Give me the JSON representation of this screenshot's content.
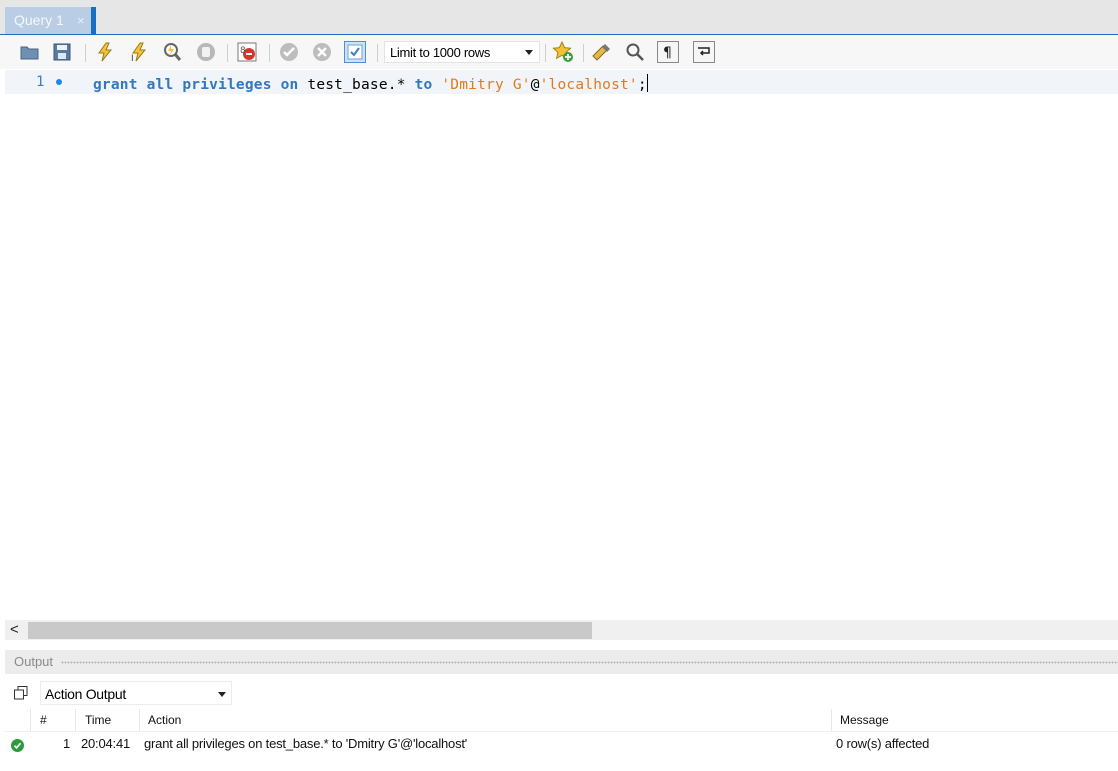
{
  "tabs": [
    {
      "label": "Query 1",
      "close": "×"
    }
  ],
  "toolbar": {
    "limit_select": "Limit to 1000 rows"
  },
  "editor": {
    "line_number": "1",
    "code_tokens": {
      "t1": "grant",
      "t2": "all",
      "t3": "privileges",
      "t4": "on",
      "t5": "test_base.*",
      "t6": "to",
      "t7": "'Dmitry G'",
      "t8": "@",
      "t9": "'localhost'",
      "t10": ";"
    }
  },
  "scroll": {
    "left_arrow": "<"
  },
  "output": {
    "title": "Output",
    "selector": "Action Output",
    "columns": [
      "#",
      "Time",
      "Action",
      "Message"
    ],
    "rows": [
      {
        "num": "1",
        "time": "20:04:41",
        "action": "grant all privileges on test_base.* to 'Dmitry G'@'localhost'",
        "message": "0 row(s) affected",
        "status": "success"
      }
    ]
  },
  "colors": {
    "accent": "#1a6fc4",
    "keyword": "#2f78c3",
    "string": "#e07a1f",
    "success": "#2e9a3a"
  }
}
